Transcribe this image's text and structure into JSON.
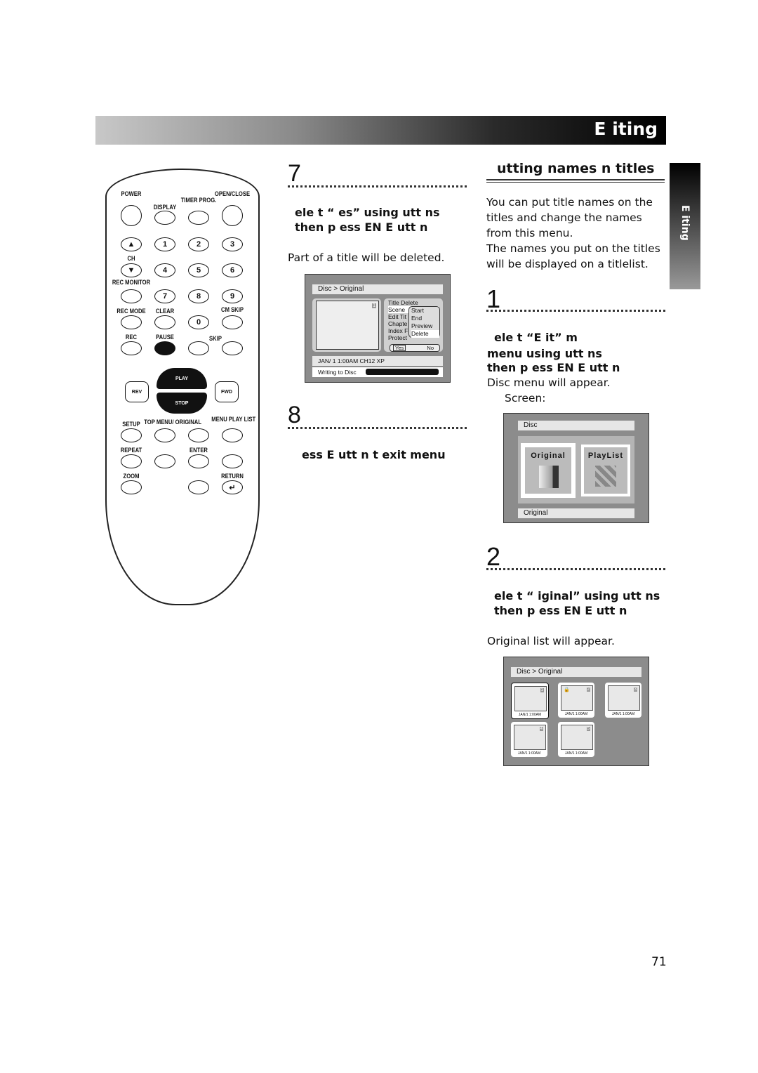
{
  "header": {
    "section": "E  iting"
  },
  "side_tab": {
    "label": "E  iting"
  },
  "remote": {
    "power": "POWER",
    "display": "DISPLAY",
    "timer_prog": "TIMER PROG.",
    "open_close": "OPEN/CLOSE",
    "ch": "CH",
    "up": "▲",
    "down": "▼",
    "digits": [
      "1",
      "2",
      "3",
      "4",
      "5",
      "6",
      "7",
      "8",
      "9",
      "0"
    ],
    "rec_monitor": "REC MONITOR",
    "rec_mode": "REC MODE",
    "clear": "CLEAR",
    "cm_skip": "CM SKIP",
    "rec": "REC",
    "pause": "PAUSE",
    "skip": "SKIP",
    "rev": "REV",
    "play": "PLAY",
    "fwd": "FWD",
    "stop": "STOP",
    "setup": "SETUP",
    "top_menu": "TOP MENU/ ORIGINAL",
    "menu_play_list": "MENU PLAY LIST",
    "repeat": "REPEAT",
    "enter": "ENTER",
    "zoom": "ZOOM",
    "return": "RETURN",
    "return_icon": "↵"
  },
  "step7": {
    "number": "7",
    "instruction": "ele t “   es” using  utt  ns  then p  ess EN   E  utt  n",
    "note": "Part of a title will be deleted.",
    "screen": {
      "breadcrumb": "Disc > Original",
      "thumb_no": "1",
      "menu": [
        "Title Delete",
        "Scene",
        "Edit Tit",
        "Chapte",
        "Index F",
        "Protect"
      ],
      "popup": [
        "Start",
        "End",
        "Preview",
        "Delete"
      ],
      "yes": "Yes",
      "no": "No",
      "status": "JAN/ 1   1:00AM  CH12     XP",
      "writing": "Writing to Disc"
    }
  },
  "step8": {
    "number": "8",
    "instruction": "ess   E          utt  n t   exit      menu"
  },
  "section": {
    "title": "utting names   n titles",
    "intro": "You can put title names on the titles and change the names from this menu.",
    "intro2": "The names you put on the titles will be displayed on a titlelist."
  },
  "step1": {
    "number": "1",
    "instruction_l1": "ele  t “E  it”      m",
    "instruction_l2": "menu using             utt  ns",
    "instruction_l3": "then p  ess EN   E     utt  n",
    "note": "Disc menu will appear.",
    "note2": "Screen:",
    "screen": {
      "top": "Disc",
      "original": "Original",
      "playlist": "PlayList",
      "bottom": "Original"
    }
  },
  "step2": {
    "number": "2",
    "instruction": "ele  t “    iginal” using  utt  ns  then p  ess EN   E  utt  n",
    "note": "Original list will appear.",
    "screen": {
      "breadcrumb": "Disc > Original",
      "thumbs": [
        {
          "n": "1",
          "date": "JAN/1   1:00AM"
        },
        {
          "n": "2",
          "date": "JAN/1   1:00AM",
          "lock": "🔒"
        },
        {
          "n": "3",
          "date": "JAN/1   1:00AM"
        },
        {
          "n": "4",
          "date": "JAN/1   1:00AM"
        },
        {
          "n": "5",
          "date": "JAN/1   1:00AM"
        }
      ]
    }
  },
  "page_number": "71"
}
